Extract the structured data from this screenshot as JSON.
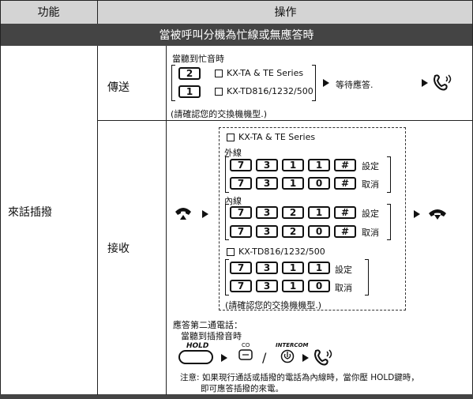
{
  "header": {
    "col1": "功能",
    "col2": "操作"
  },
  "section_title": "當被呼叫分機為忙線或無應答時",
  "feature": "來話插撥",
  "send": {
    "label": "傳送",
    "busy_tone": "當聽到忙音時",
    "key_a": "2",
    "key_b": "1",
    "model_a": "KX-TA & TE Series",
    "model_b": "KX-TD816/1232/500",
    "wait": "等待應答.",
    "note": "(請確認您的交換機機型.)"
  },
  "receive": {
    "label": "接收",
    "model_a": "KX-TA & TE Series",
    "outside": "外線",
    "outside_set": [
      "7",
      "3",
      "1",
      "1",
      "#"
    ],
    "outside_cancel": [
      "7",
      "3",
      "1",
      "0",
      "#"
    ],
    "inside": "內線",
    "inside_set": [
      "7",
      "3",
      "2",
      "1",
      "#"
    ],
    "inside_cancel": [
      "7",
      "3",
      "2",
      "0",
      "#"
    ],
    "set_label": "設定",
    "cancel_label": "取消",
    "model_b": "KX-TD816/1232/500",
    "td_set": [
      "7",
      "3",
      "1",
      "1"
    ],
    "td_cancel": [
      "7",
      "3",
      "1",
      "0"
    ],
    "note": "(請確認您的交換機機型.)",
    "answer_second": "應答第二通電話：",
    "hear_tone": "當聽到插撥音時",
    "hold": "HOLD",
    "co": "CO",
    "intercom": "INTERCOM",
    "slash": "/",
    "caution": "注意: 如果現行通話或插撥的電話為內線時，當你壓 HOLD鍵時，",
    "caution2": "即可應答插撥的來電。"
  },
  "icons": [
    "handset-talking-icon",
    "handset-lift-icon",
    "handset-hangup-icon",
    "hold-button-icon",
    "co-button-icon",
    "intercom-button-icon"
  ]
}
